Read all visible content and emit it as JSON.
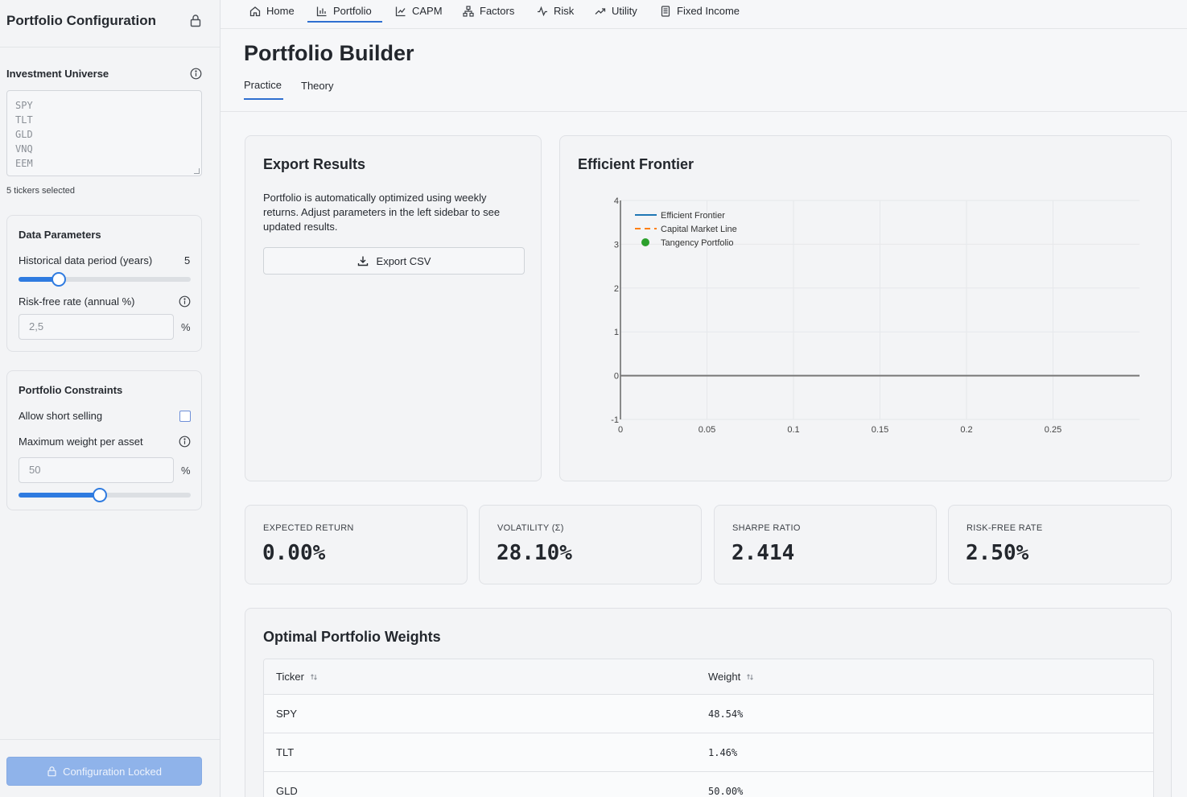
{
  "sidebar": {
    "title": "Portfolio Configuration",
    "universe_label": "Investment Universe",
    "tickers": [
      "SPY",
      "TLT",
      "GLD",
      "VNQ",
      "EEM"
    ],
    "tickers_note": "5 tickers selected",
    "data_params": {
      "title": "Data Parameters",
      "period_label": "Historical data period (years)",
      "period_value": "5",
      "period_slider_fraction": 0.23,
      "rf_label": "Risk-free rate (annual %)",
      "rf_placeholder": "2,5",
      "rf_unit": "%"
    },
    "constraints": {
      "title": "Portfolio Constraints",
      "short_label": "Allow short selling",
      "short_checked": false,
      "max_weight_label": "Maximum weight per asset",
      "max_weight_placeholder": "50",
      "max_weight_unit": "%",
      "max_weight_slider_fraction": 0.47
    },
    "locked_button": "Configuration Locked"
  },
  "nav": {
    "items": [
      {
        "label": "Home",
        "icon": "home-icon"
      },
      {
        "label": "Portfolio",
        "icon": "bar-chart-icon",
        "active": true
      },
      {
        "label": "CAPM",
        "icon": "line-chart-icon"
      },
      {
        "label": "Factors",
        "icon": "network-icon"
      },
      {
        "label": "Risk",
        "icon": "activity-icon"
      },
      {
        "label": "Utility",
        "icon": "trend-up-icon"
      },
      {
        "label": "Fixed Income",
        "icon": "document-icon"
      }
    ]
  },
  "header": {
    "title": "Portfolio Builder",
    "tabs": [
      "Practice",
      "Theory"
    ],
    "active_tab": "Practice"
  },
  "export": {
    "title": "Export Results",
    "description": "Portfolio is automatically optimized using weekly returns. Adjust parameters in the left sidebar to see updated results.",
    "button": "Export CSV"
  },
  "frontier": {
    "title": "Efficient Frontier"
  },
  "chart_data": {
    "type": "line",
    "title": "Efficient Frontier",
    "xlabel": "",
    "ylabel": "",
    "xlim": [
      0,
      0.3
    ],
    "ylim": [
      -1,
      4
    ],
    "x_ticks": [
      "0",
      "0.05",
      "0.1",
      "0.15",
      "0.2",
      "0.25"
    ],
    "y_ticks": [
      "-1",
      "0",
      "1",
      "2",
      "3",
      "4"
    ],
    "grid": true,
    "legend_position": "top-left",
    "series": [
      {
        "name": "Efficient Frontier",
        "style": "solid",
        "color": "#1f77b4",
        "points": []
      },
      {
        "name": "Capital Market Line",
        "style": "dashed",
        "color": "#ff7f0e",
        "points": []
      },
      {
        "name": "Tangency Portfolio",
        "style": "marker",
        "color": "#2ca02c",
        "points": []
      }
    ]
  },
  "metrics": [
    {
      "label": "EXPECTED RETURN",
      "value": "0.00%"
    },
    {
      "label": "VOLATILITY (Σ)",
      "value": "28.10%"
    },
    {
      "label": "SHARPE RATIO",
      "value": "2.414"
    },
    {
      "label": "RISK-FREE RATE",
      "value": "2.50%"
    }
  ],
  "weights": {
    "title": "Optimal Portfolio Weights",
    "columns": [
      "Ticker",
      "Weight"
    ],
    "rows": [
      {
        "ticker": "SPY",
        "weight": "48.54%"
      },
      {
        "ticker": "TLT",
        "weight": "1.46%"
      },
      {
        "ticker": "GLD",
        "weight": "50.00%"
      }
    ]
  }
}
